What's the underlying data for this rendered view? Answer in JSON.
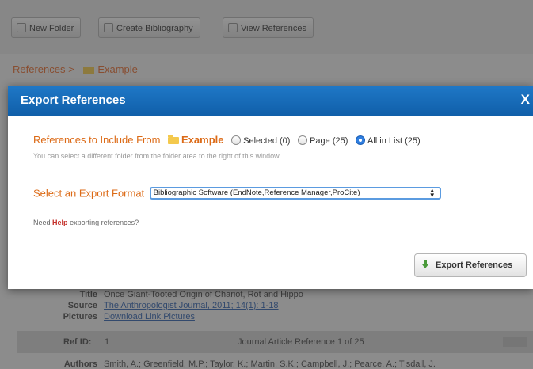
{
  "toolbar": {
    "new_folder": "New Folder",
    "create_bibliography": "Create Bibliography",
    "view_references": "View References"
  },
  "breadcrumb": {
    "root": "References",
    "separator": ">",
    "folder": "Example"
  },
  "background_detail": {
    "title_label": "Title",
    "title_value": "Once Giant-Tooted Origin of Chariot, Rot and Hippo",
    "source_label": "Source",
    "source_value": "The Anthropologist Journal, 2011; 14(1): 1-18",
    "pictures_label": "Pictures",
    "pictures_value": "Download Link Pictures",
    "ref_id_label": "Ref ID:",
    "ref_id_value": "1",
    "ref_count": "Journal Article Reference 1 of 25",
    "authors_label": "Authors",
    "authors_value": "Smith, A.; Greenfield, M.P.; Taylor, K.; Martin, S.K.; Campbell, J.; Pearce, A.; Tisdall, J."
  },
  "modal": {
    "title": "Export References",
    "close": "X",
    "include_label": "References to Include From",
    "folder_name": "Example",
    "options": {
      "selected": "Selected (0)",
      "page": "Page (25)",
      "all": "All in List (25)"
    },
    "selected_option": "all",
    "hint": "You can select a different folder from the folder area to the right of this window.",
    "format_label": "Select an Export Format",
    "format_value": "Bibliographic Software (EndNote,Reference Manager,ProCite)",
    "help_prefix": "Need",
    "help_link": "Help",
    "help_suffix": "exporting references?",
    "export_button": "Export References"
  },
  "colors": {
    "header_blue": "#1a6dbd",
    "orange_text": "#dc6a16",
    "radio_checked": "#2f7ee0"
  }
}
